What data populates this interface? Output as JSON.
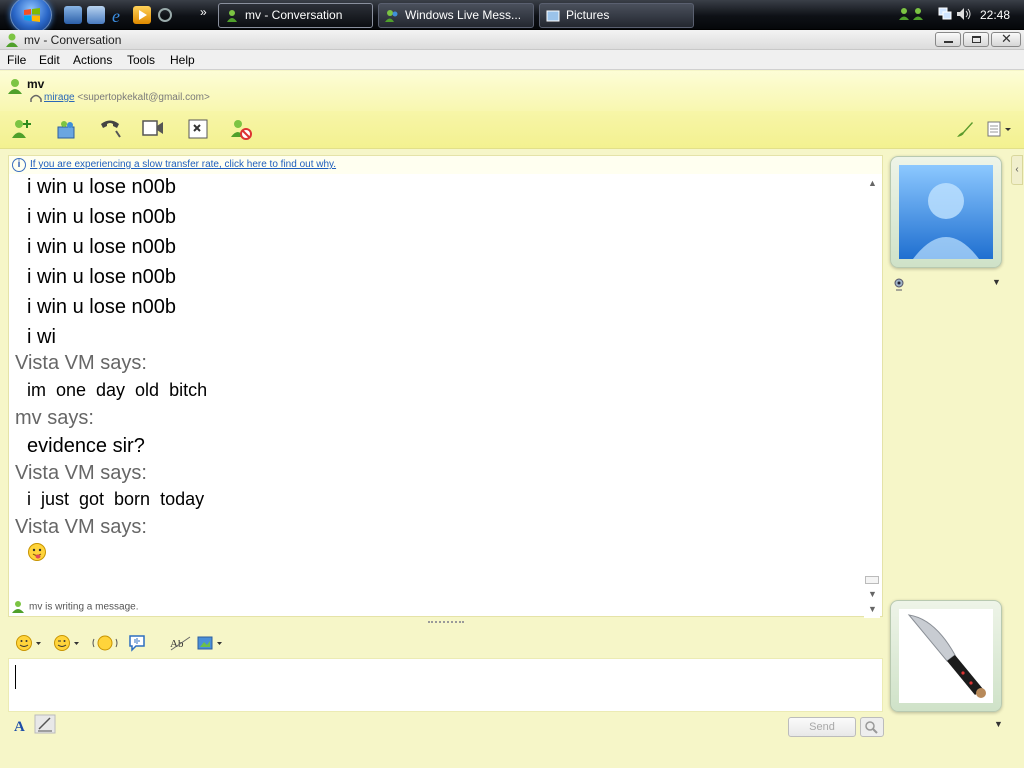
{
  "taskbar": {
    "tasks": [
      {
        "label": "mv - Conversation"
      },
      {
        "label": "Windows Live Mess..."
      },
      {
        "label": "Pictures"
      }
    ],
    "clock": "22:48"
  },
  "window": {
    "title": "mv - Conversation"
  },
  "menu": {
    "items": [
      "File",
      "Edit",
      "Actions",
      "Tools",
      "Help"
    ]
  },
  "contact": {
    "name": "mv",
    "display_name": "mirage",
    "email": "<supertopkekalt@gmail.com>"
  },
  "info_bar": {
    "text": "If you are experiencing a slow transfer rate, click here to find out why."
  },
  "messages": [
    {
      "type": "text",
      "text": "i win u lose n00b"
    },
    {
      "type": "text",
      "text": "i win u lose n00b"
    },
    {
      "type": "text",
      "text": "i win u lose n00b"
    },
    {
      "type": "text",
      "text": "i win u lose n00b"
    },
    {
      "type": "text",
      "text": "i win u lose n00b"
    },
    {
      "type": "text",
      "text": "i wi"
    },
    {
      "type": "sender",
      "text": "Vista VM says:"
    },
    {
      "type": "text",
      "text": "im one day old bitch"
    },
    {
      "type": "sender",
      "text": "mv says:"
    },
    {
      "type": "text",
      "text": "evidence sir?"
    },
    {
      "type": "sender",
      "text": "Vista VM says:"
    },
    {
      "type": "text",
      "text": "i just got born today"
    },
    {
      "type": "sender",
      "text": "Vista VM says:"
    },
    {
      "type": "emoticon",
      "icon": "tongue-out-emoticon"
    }
  ],
  "status": {
    "typing": "mv is writing a message."
  },
  "compose": {
    "send_label": "Send"
  },
  "colors": {
    "chrome_yellow": "#f6f6c8",
    "toolbar_yellow": "#f3f190",
    "link_blue": "#1f5fbd",
    "sender_gray": "#666666"
  },
  "icons": {
    "toolbar": [
      "invite-contact-icon",
      "share-files-icon",
      "call-icon",
      "video-call-icon",
      "games-icon",
      "block-icon"
    ],
    "format": [
      "emoticon-icon",
      "wink-icon",
      "nudge-icon",
      "voice-clip-icon",
      "spell-check-icon",
      "background-icon"
    ],
    "right_toolbar": [
      "paintbrush-icon",
      "menu-icon"
    ]
  }
}
